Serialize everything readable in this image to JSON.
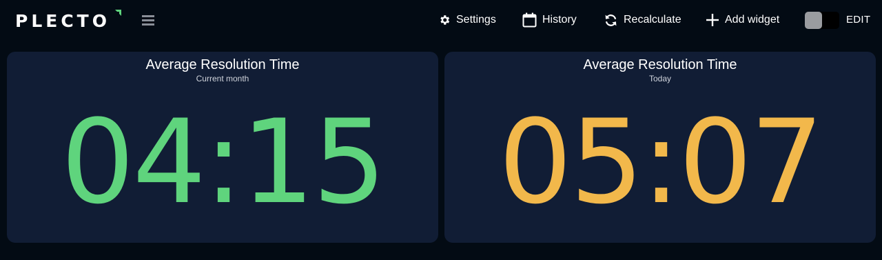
{
  "app": {
    "logo_text": "PLECTO"
  },
  "colors": {
    "background": "#030b14",
    "panel": "#111d35",
    "accent_green": "#5fd47d",
    "accent_yellow": "#f2b84b",
    "toggle_knob": "#9a9ca0"
  },
  "header": {
    "menu_icon": "hamburger-icon",
    "settings": {
      "label": "Settings",
      "icon": "gear-icon"
    },
    "history": {
      "label": "History",
      "icon": "calendar-icon"
    },
    "recalculate": {
      "label": "Recalculate",
      "icon": "refresh-icon"
    },
    "add_widget": {
      "label": "Add widget",
      "icon": "plus-icon"
    },
    "edit_toggle": {
      "label": "EDIT",
      "state": "off"
    }
  },
  "widgets": [
    {
      "title": "Average Resolution Time",
      "subtitle": "Current month",
      "value": "04:15",
      "color": "#5fd47d"
    },
    {
      "title": "Average Resolution Time",
      "subtitle": "Today",
      "value": "05:07",
      "color": "#f2b84b"
    }
  ]
}
